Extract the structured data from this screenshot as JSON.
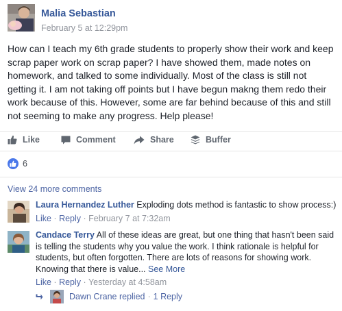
{
  "post": {
    "author": "Malia Sebastian",
    "timestamp": "February 5 at 12:29pm",
    "body": "How can I teach my 6th grade students to properly show their work and keep scrap paper work on scrap paper? I have showed them, made notes on homework, and talked to some individually. Most of the class is still not getting it. I am not taking off points but I have begun makng them redo their work because of this. However, some are far behind because of this and still not seeming to make any progress. Help please!"
  },
  "actions": {
    "like": "Like",
    "comment": "Comment",
    "share": "Share",
    "buffer": "Buffer"
  },
  "reactions": {
    "count": "6",
    "icon": "thumbs-up-icon",
    "color": "#4a78ea"
  },
  "comments_section": {
    "view_more": "View 24 more comments",
    "comments": [
      {
        "author": "Laura Hernandez Luther",
        "text": "Exploding dots method is fantastic to show process:)",
        "like": "Like",
        "reply": "Reply",
        "time": "February 7 at 7:32am"
      },
      {
        "author": "Candace Terry",
        "text": "All of these ideas are great, but one thing that hasn't been said is telling the students why you value the work. I think rationale is helpful for students, but often forgotten. There are lots of reasons for showing work. Knowing that there is value...",
        "see_more": "See More",
        "like": "Like",
        "reply": "Reply",
        "time": "Yesterday at 4:58am"
      }
    ],
    "reply_summary": {
      "text": "Dawn Crane replied",
      "count": "1 Reply"
    }
  },
  "colors": {
    "link": "#365899",
    "muted": "#90949c",
    "text": "#1d2129",
    "divider": "#e5e5e5"
  }
}
